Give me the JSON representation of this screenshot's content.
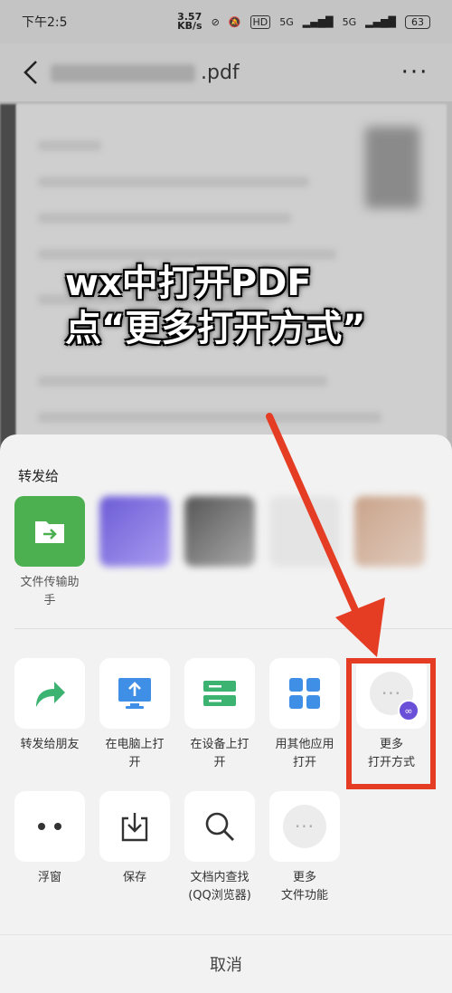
{
  "status": {
    "time": "下午2:5",
    "speed": "3.57\nKB/s",
    "hd": "HD",
    "net1": "5G",
    "net2": "5G",
    "battery": "63"
  },
  "nav": {
    "title_suffix": ".pdf",
    "more": "···"
  },
  "overlay": {
    "line1": "wx中打开PDF",
    "line2": "点“更多打开方式”"
  },
  "sheet": {
    "share_label": "转发给",
    "contacts": [
      {
        "name": "文件传输助\n手"
      },
      {
        "name": ""
      },
      {
        "name": ""
      },
      {
        "name": ""
      },
      {
        "name": ""
      }
    ],
    "actions_row1": [
      {
        "label": "转发给朋友",
        "icon": "share-arrow-icon"
      },
      {
        "label": "在电脑上打\n开",
        "icon": "computer-upload-icon"
      },
      {
        "label": "在设备上打\n开",
        "icon": "device-icon"
      },
      {
        "label": "用其他应用\n打开",
        "icon": "apps-grid-icon"
      },
      {
        "label": "更多\n打开方式",
        "icon": "more-dots-icon"
      }
    ],
    "actions_row2": [
      {
        "label": "浮窗",
        "icon": "float-window-icon"
      },
      {
        "label": "保存",
        "icon": "download-icon"
      },
      {
        "label": "文档内查找\n(QQ浏览器)",
        "icon": "search-icon"
      },
      {
        "label": "更多\n文件功能",
        "icon": "more-dots-icon"
      }
    ],
    "cancel": "取消"
  },
  "colors": {
    "accent_red": "#e53c24",
    "green": "#4caf50",
    "blue": "#3f8fe6",
    "sheet_bg": "#f2f2f2"
  }
}
